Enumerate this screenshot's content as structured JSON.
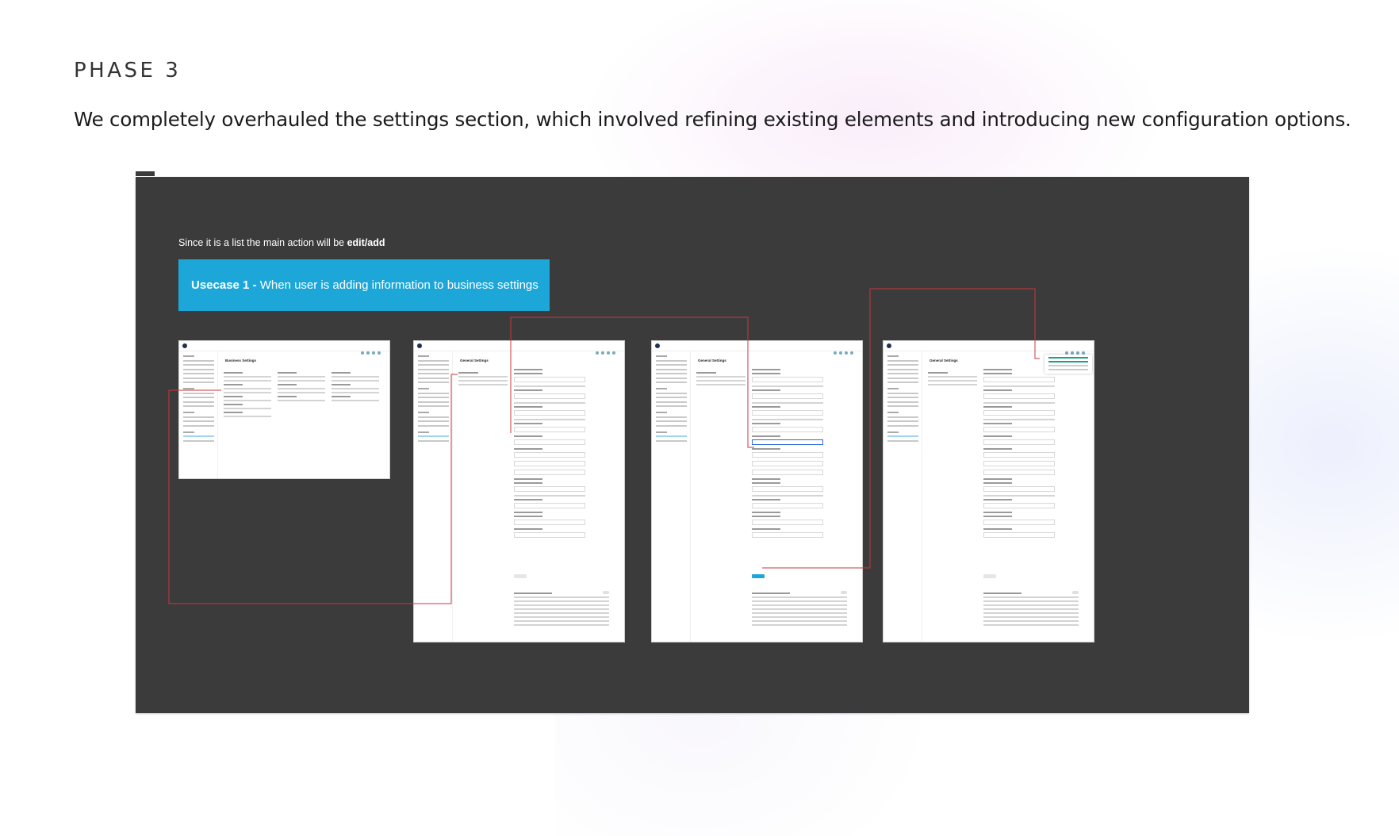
{
  "page": {
    "phase_heading": "PHASE 3",
    "description": "We completely overhauled the settings section, which involved refining existing elements and introducing new configuration options."
  },
  "board": {
    "note_prefix": "Since it is a list the main action will be ",
    "note_emphasis": "edit/add",
    "usecase_prefix": "Usecase 1 - ",
    "usecase_text": "When user is adding information to business settings",
    "connector_color": "#c8373d",
    "accent_color": "#1da7d9"
  },
  "screens": [
    {
      "name": "business-settings-overview",
      "title": "Business Settings"
    },
    {
      "name": "general-settings-empty",
      "title": "General Settings"
    },
    {
      "name": "general-settings-editing",
      "title": "General Settings",
      "save_label": "Save"
    },
    {
      "name": "general-settings-saved",
      "title": "General Settings"
    }
  ]
}
